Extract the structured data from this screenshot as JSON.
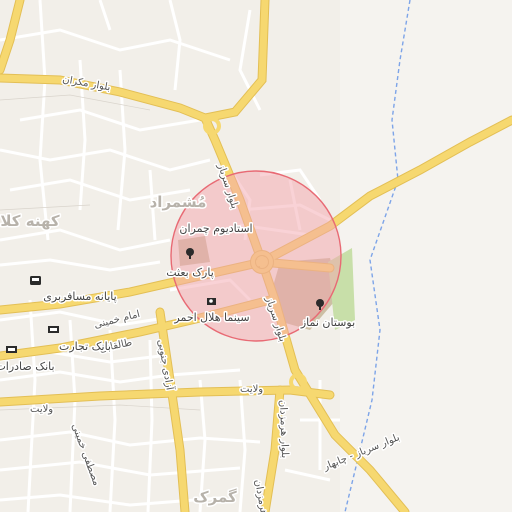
{
  "labels": {
    "blvd_mokran": "بلوار مکران",
    "blvd_sarbaz": "بلوار سرباز",
    "blvd_sarbaz_2": "بلوار سرباز",
    "blvd_hormozdan": "بلوار هرمزدان",
    "sarbaz_chabahar": "بلوار سرباز - چابهار",
    "imam_khomeini": "امام خمینی",
    "taleghani": "طالقانی",
    "azadi_south": "آزادی جنوبی",
    "velayat": "ولایت",
    "velayat_2": "ولایت",
    "bank_tejarat": "بانک تجارت",
    "bank_saderat": "بانک صادرات",
    "terminal": "پایانه مسافربری",
    "stadium": "استادیوم چمران",
    "park_beasat": "پارک بعثت",
    "cinema": "سینما هلال احمر",
    "park_namaz": "بوستان نماز",
    "hood_marad": "مُشمراد",
    "hood_kohneh": "کهنه کلا",
    "hood_gomrok": "گمرک",
    "street_misc": "مصطفی خمینی",
    "street_misc2": "هرمزدان"
  },
  "colors": {
    "background": "#f2efe9",
    "major_road": "#f6d870",
    "major_road_casing": "#e3bf55",
    "minor_road": "#ffffff",
    "minor_road_casing": "#d9d4cc",
    "highlight_circle_fill": "#f3a6ad",
    "highlight_circle_stroke": "#e86a74",
    "park": "#c8dfa9",
    "stadium_area": "#cdbfa4",
    "river": "#7da4e8"
  },
  "icons": {
    "bus_stop": "bus-icon",
    "bank": "bank-icon",
    "park": "tree-icon",
    "cinema": "camera-icon"
  }
}
